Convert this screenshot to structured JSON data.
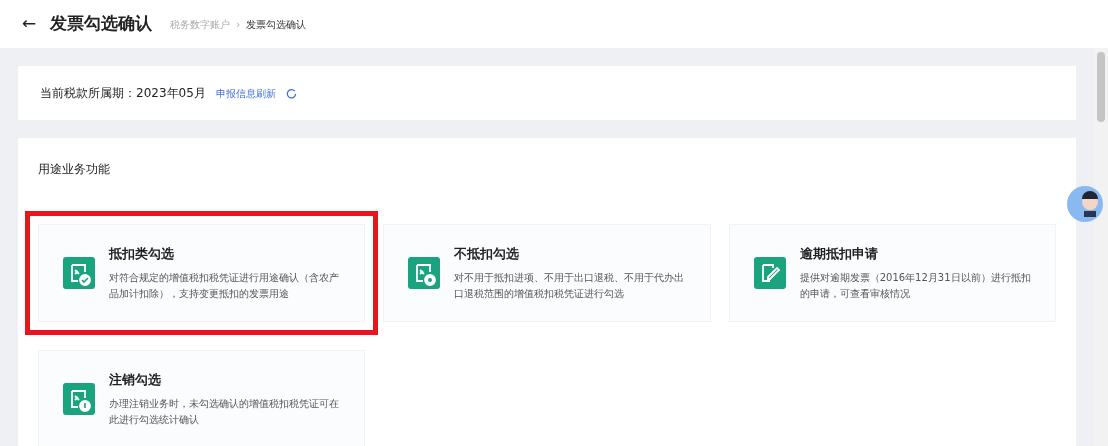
{
  "header": {
    "back": "←",
    "title": "发票勾选确认",
    "breadcrumb": [
      {
        "label": "税务数字账户",
        "current": false
      },
      {
        "label": "发票勾选确认",
        "current": true
      }
    ],
    "separator": "›"
  },
  "period": {
    "label": "当前税款所属期：2023年05月",
    "link": "申报信息刷新"
  },
  "section": {
    "title": "用途业务功能",
    "cards": [
      {
        "kind": "check",
        "title": "抵扣类勾选",
        "description": "对符合规定的增值税扣税凭证进行用途确认（含农产品加计扣除），支持变更抵扣的发票用途",
        "highlighted": true
      },
      {
        "kind": "stamp",
        "title": "不抵扣勾选",
        "description": "对不用于抵扣进项、不用于出口退税、不用于代办出口退税范围的增值税扣税凭证进行勾选",
        "highlighted": false
      },
      {
        "kind": "pen",
        "title": "逾期抵扣申请",
        "description": "提供对逾期发票（2016年12月31日以前）进行抵扣的申请，可查看审核情况",
        "highlighted": false
      },
      {
        "kind": "cancel",
        "title": "注销勾选",
        "description": "办理注销业务时，未勾选确认的增值税扣税凭证可在此进行勾选统计确认",
        "highlighted": false
      }
    ]
  }
}
